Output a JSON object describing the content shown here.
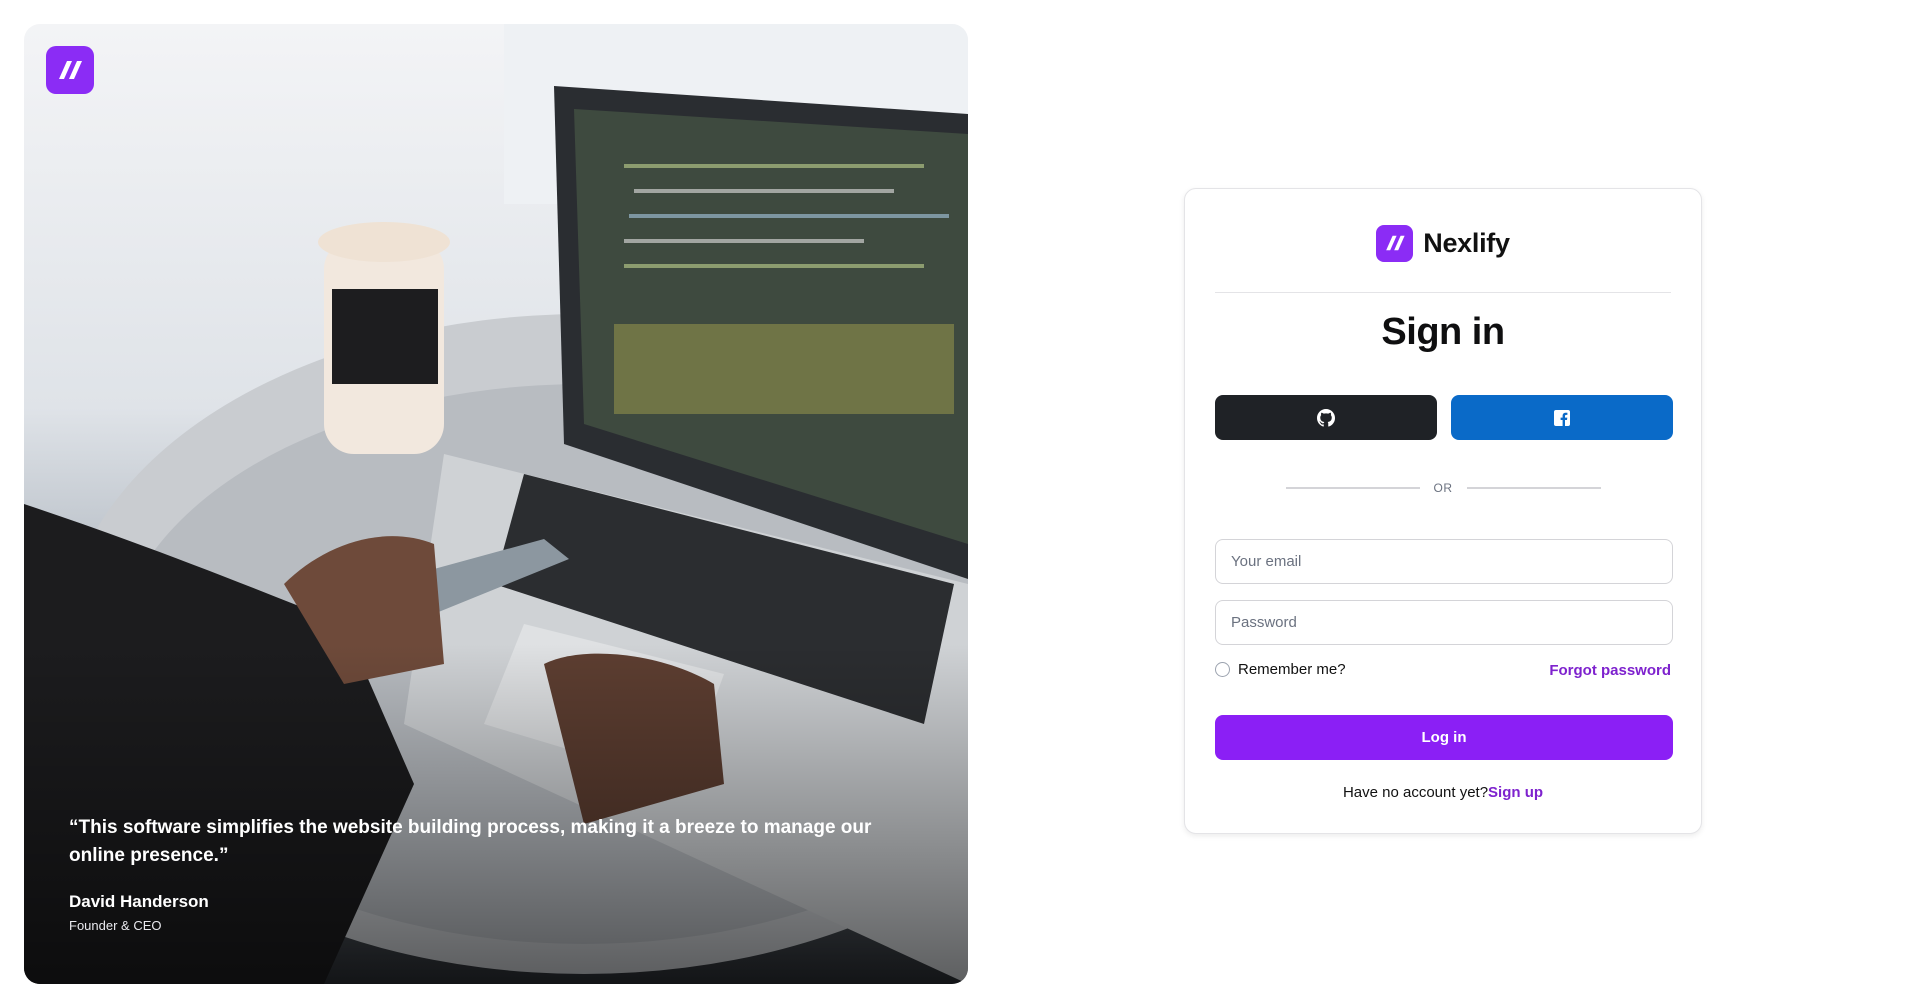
{
  "hero": {
    "logo_icon": "nexlify-logo-icon",
    "quote": "“This software simplifies the website building process, making it a breeze to manage our online presence.”",
    "author_name": "David Handerson",
    "author_role": "Founder & CEO"
  },
  "brand": {
    "name": "Nexlify",
    "color": "#8b2cf5"
  },
  "signin": {
    "title": "Sign in",
    "github_icon": "github-icon",
    "facebook_icon": "facebook-icon",
    "divider_text": "OR",
    "email_placeholder": "Your email",
    "password_placeholder": "Password",
    "remember_label": "Remember me?",
    "forgot_label": "Forgot password",
    "login_label": "Log in",
    "no_account_text": "Have no account yet?",
    "signup_label": "Sign up"
  },
  "colors": {
    "accent": "#8b1ff5",
    "github_bg": "#1f2226",
    "facebook_bg": "#0a6ac8",
    "link": "#7e22ce"
  }
}
